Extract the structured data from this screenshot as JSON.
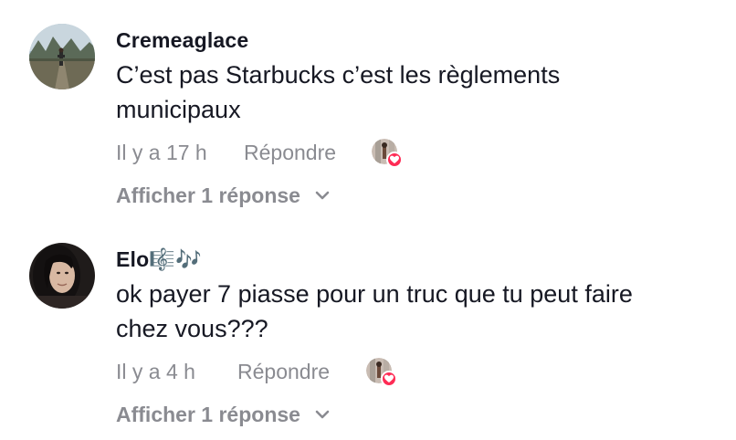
{
  "comments": [
    {
      "username": "Cremeaglace",
      "text": "C’est pas Starbucks c’est les règlements municipaux",
      "timestamp": "Il y a 17 h",
      "reply_label": "Répondre",
      "view_replies": "Afficher 1 réponse"
    },
    {
      "username": "Elo🎼🎶",
      "text": "ok payer 7 piasse pour un truc que tu peut faire chez vous???",
      "timestamp": "Il y a 4 h",
      "reply_label": "Répondre",
      "view_replies": "Afficher 1 réponse"
    }
  ],
  "colors": {
    "primary_text": "#161823",
    "secondary_text": "#8a8b91",
    "heart": "#fe2c55"
  },
  "icons": {
    "liked_badge": "heart-icon",
    "expand": "chevron-down-icon"
  }
}
